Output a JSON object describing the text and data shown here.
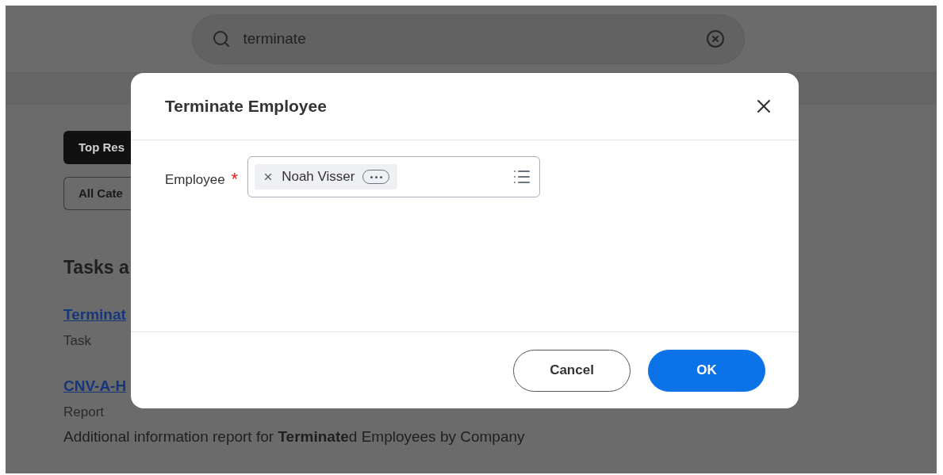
{
  "search": {
    "value": "terminate"
  },
  "filters": [
    {
      "label": "Top Res",
      "selected": true
    },
    {
      "label": "All Cate",
      "selected": false
    }
  ],
  "section_title": "Tasks a",
  "results": [
    {
      "title": "Terminat",
      "type": "Task"
    },
    {
      "title": "CNV-A-H",
      "type": "Report",
      "description": "Additional information report for **Terminate**d Employees by Company"
    }
  ],
  "dialog": {
    "title": "Terminate Employee",
    "field": {
      "label": "Employee",
      "required_mark": "*",
      "tokens": [
        "Noah Visser"
      ]
    },
    "buttons": [
      {
        "label": "Cancel",
        "kind": "secondary"
      },
      {
        "label": "OK",
        "kind": "primary"
      }
    ]
  }
}
